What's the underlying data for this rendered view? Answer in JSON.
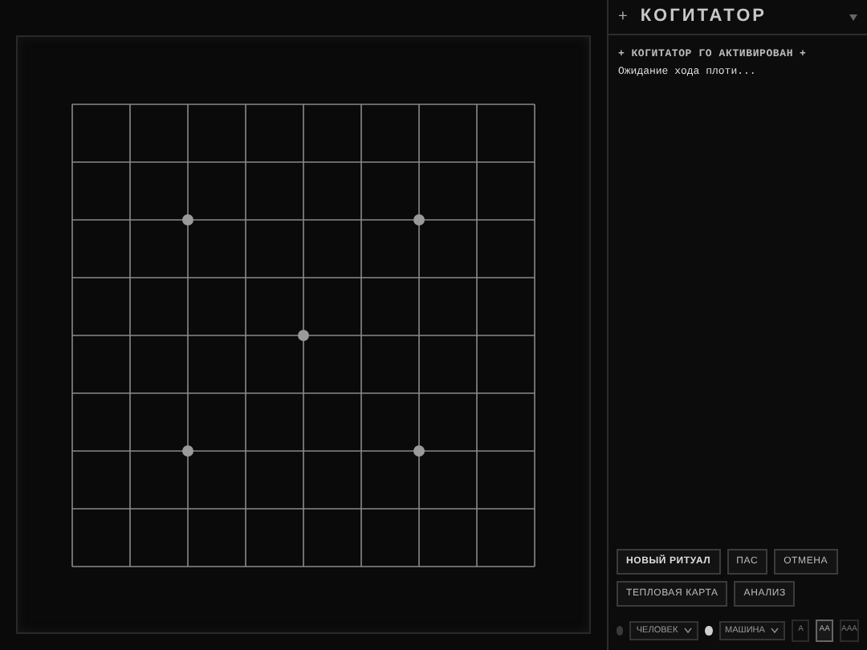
{
  "board": {
    "kind": "nine"
  },
  "panel": {
    "title_mark": "+",
    "title": "КОГИТАТОР",
    "log": [
      {
        "kind": "banner",
        "mark": "+",
        "text": "КОГИТАТОР ГО АКТИВИРОВАН",
        "end_mark": "+"
      },
      {
        "kind": "line",
        "text": "Ожидание хода плоти..."
      }
    ],
    "actions": [
      [
        "НОВЫЙ РИТУАЛ",
        "ПАС",
        "ОТМЕНА"
      ],
      [
        "ТЕПЛОВАЯ КАРТА",
        "АНАЛИЗ"
      ]
    ],
    "players": [
      {
        "color": "#3a3a3a",
        "value": "ЧЕЛОВЕК"
      },
      {
        "color": "#d0d0d0",
        "value": "МАШИНА"
      }
    ],
    "levels": [
      {
        "label": "A",
        "selected": false
      },
      {
        "label": "AA",
        "selected": true
      },
      {
        "label": "AAA",
        "selected": false
      }
    ]
  }
}
